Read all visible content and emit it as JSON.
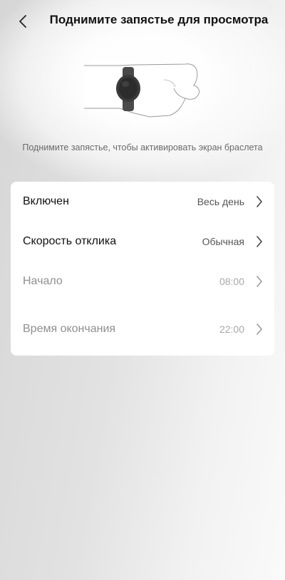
{
  "header": {
    "title": "Поднимите запястье для просмотра",
    "back_icon": "chevron-left-icon"
  },
  "illustration": {
    "icon": "wrist-band-icon"
  },
  "hint": "Поднимите запястье, чтобы активировать экран браслета",
  "settings": {
    "items": [
      {
        "label": "Включен",
        "value": "Весь день",
        "enabled": true
      },
      {
        "label": "Скорость отклика",
        "value": "Обычная",
        "enabled": true
      },
      {
        "label": "Начало",
        "value": "08:00",
        "enabled": false
      },
      {
        "label": "Время окончания",
        "value": "22:00",
        "enabled": false
      }
    ]
  },
  "colors": {
    "card": "#ffffff",
    "text_primary": "#111111",
    "text_disabled": "#8f8f8f"
  }
}
